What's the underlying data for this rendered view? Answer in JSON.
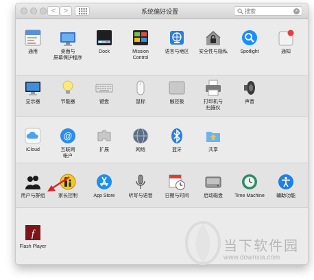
{
  "window": {
    "title": "系统偏好设置",
    "nav_back": "<",
    "nav_forward": ">",
    "search_placeholder": "搜索",
    "search_clear": "×"
  },
  "row1": [
    {
      "label": "通用",
      "icon": "general-icon"
    },
    {
      "label": "桌面与\n屏幕保护程序",
      "icon": "desktop-screensaver-icon"
    },
    {
      "label": "Dock",
      "icon": "dock-icon"
    },
    {
      "label": "Mission\nControl",
      "icon": "mission-control-icon"
    },
    {
      "label": "语言与地区",
      "icon": "language-region-icon"
    },
    {
      "label": "安全性与隐私",
      "icon": "security-privacy-icon"
    },
    {
      "label": "Spotlight",
      "icon": "spotlight-icon"
    },
    {
      "label": "通知",
      "icon": "notifications-icon"
    }
  ],
  "row2": [
    {
      "label": "显示器",
      "icon": "displays-icon"
    },
    {
      "label": "节能器",
      "icon": "energy-saver-icon"
    },
    {
      "label": "键盘",
      "icon": "keyboard-icon"
    },
    {
      "label": "鼠标",
      "icon": "mouse-icon"
    },
    {
      "label": "触控板",
      "icon": "trackpad-icon"
    },
    {
      "label": "打印机与\n扫描仪",
      "icon": "printers-scanners-icon"
    },
    {
      "label": "声音",
      "icon": "sound-icon"
    }
  ],
  "row3": [
    {
      "label": "iCloud",
      "icon": "icloud-icon"
    },
    {
      "label": "互联网\n帐户",
      "icon": "internet-accounts-icon"
    },
    {
      "label": "扩展",
      "icon": "extensions-icon"
    },
    {
      "label": "网络",
      "icon": "network-icon"
    },
    {
      "label": "蓝牙",
      "icon": "bluetooth-icon"
    },
    {
      "label": "共享",
      "icon": "sharing-icon"
    }
  ],
  "row4": [
    {
      "label": "用户与群组",
      "icon": "users-groups-icon"
    },
    {
      "label": "家长控制",
      "icon": "parental-controls-icon"
    },
    {
      "label": "App Store",
      "icon": "app-store-icon"
    },
    {
      "label": "听写与语音",
      "icon": "dictation-speech-icon"
    },
    {
      "label": "日期与时间",
      "icon": "date-time-icon"
    },
    {
      "label": "启动磁盘",
      "icon": "startup-disk-icon"
    },
    {
      "label": "Time Machine",
      "icon": "time-machine-icon"
    },
    {
      "label": "辅助功能",
      "icon": "accessibility-icon"
    }
  ],
  "row5": [
    {
      "label": "Flash Player",
      "icon": "flash-player-icon"
    }
  ],
  "watermark": {
    "text": "当下软件园",
    "url": "www.downxia.com"
  },
  "colors": {
    "annotation_arrow": "#e02020",
    "accent_blue": "#1a8cff"
  }
}
